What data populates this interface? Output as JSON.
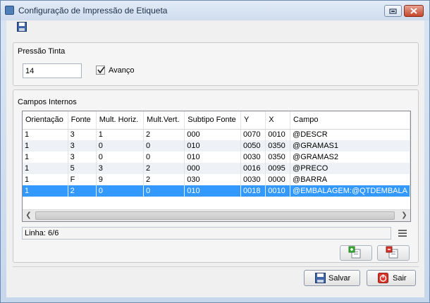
{
  "window": {
    "title": "Configuração de Impressão de Etiqueta",
    "minimize_icon": "minimize-icon",
    "close_icon": "close-icon"
  },
  "toolbar": {
    "save_icon": "floppy-disk-icon"
  },
  "pressao": {
    "label": "Pressão Tinta",
    "value": "14",
    "avanco_label": "Avanço",
    "avanco_checked": true
  },
  "campos": {
    "label": "Campos Internos",
    "columns": [
      "Orientação",
      "Fonte",
      "Mult. Horiz.",
      "Mult.Vert.",
      "Subtipo Fonte",
      "Y",
      "X",
      "Campo"
    ],
    "rows": [
      [
        "1",
        "3",
        "1",
        "2",
        "000",
        "0070",
        "0010",
        "@DESCR"
      ],
      [
        "1",
        "3",
        "0",
        "0",
        "010",
        "0050",
        "0350",
        "@GRAMAS1"
      ],
      [
        "1",
        "3",
        "0",
        "0",
        "010",
        "0030",
        "0350",
        "@GRAMAS2"
      ],
      [
        "1",
        "5",
        "3",
        "2",
        "000",
        "0016",
        "0095",
        "@PRECO"
      ],
      [
        "1",
        "F",
        "9",
        "2",
        "030",
        "0030",
        "0000",
        "@BARRA"
      ],
      [
        "1",
        "2",
        "0",
        "0",
        "010",
        "0018",
        "0010",
        "@EMBALAGEM:@QTDEMBALA"
      ]
    ],
    "selected_row": 5,
    "status": "Linha: 6/6"
  },
  "buttons": {
    "add_icon": "add-row-icon",
    "remove_icon": "remove-row-icon",
    "salvar": "Salvar",
    "sair": "Sair"
  },
  "colors": {
    "selection": "#3399ff",
    "sair_icon": "#d9352b"
  }
}
